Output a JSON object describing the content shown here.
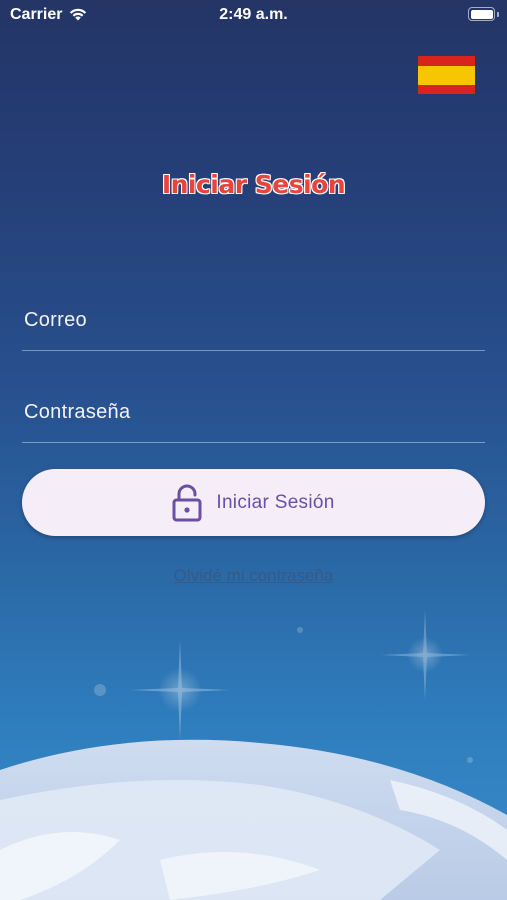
{
  "status_bar": {
    "carrier": "Carrier",
    "time": "2:49 a.m."
  },
  "language": {
    "flag": "spain-flag",
    "colors": [
      "#d9231d",
      "#f8c600"
    ]
  },
  "title": "Iniciar Sesión",
  "form": {
    "email_placeholder": "Correo",
    "password_placeholder": "Contraseña",
    "submit_label": "Iniciar Sesión",
    "submit_icon": "unlock-icon",
    "forgot_label": "Olvidé mi contraseña"
  },
  "colors": {
    "title": "#e8443c",
    "button_bg": "#f5eef8",
    "button_text": "#6a4fa3"
  }
}
